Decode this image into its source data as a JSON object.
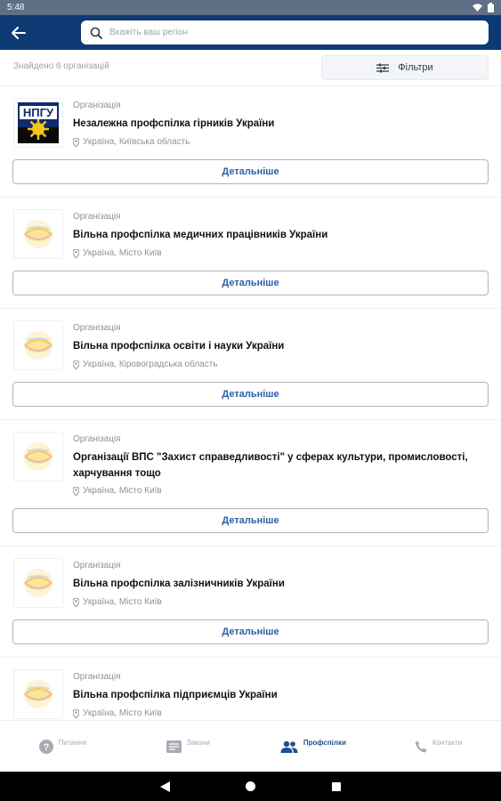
{
  "status": {
    "time": "5:48"
  },
  "search": {
    "placeholder": "Вкажіть ваш регіон"
  },
  "results": {
    "found_text": "Знайдено 6 організацій",
    "filter_label": "Фільтри"
  },
  "orgs": [
    {
      "type": "Організація",
      "name": "Незалежна профспілка гірників України",
      "location": "Україна, Київська область",
      "button": "Детальніше",
      "logo": "npgu-logo",
      "logo_text": "НПГУ"
    },
    {
      "type": "Організація",
      "name": "Вільна профспілка медичних працівників України",
      "location": "Україна, Місто Київ",
      "button": "Детальніше",
      "logo": "vpu-logo"
    },
    {
      "type": "Організація",
      "name": "Вільна профспілка освіти і науки України",
      "location": "Україна, Кіровоградська область",
      "button": "Детальніше",
      "logo": "vpu-logo"
    },
    {
      "type": "Організація",
      "name": "Організації ВПС \"Захист справедливості\" у сферах культури, промисловості, харчування тощо",
      "location": "Україна, Місто Київ",
      "button": "Детальніше",
      "logo": "vpu-logo"
    },
    {
      "type": "Організація",
      "name": "Вільна профспілка залізничників України",
      "location": "Україна, Місто Київ",
      "button": "Детальніше",
      "logo": "vpu-logo"
    },
    {
      "type": "Організація",
      "name": "Вільна профспілка підприємців України",
      "location": "Україна, Місто Київ",
      "button": "Детальніше",
      "logo": "vpu-logo"
    }
  ],
  "nav": [
    {
      "label": "Питання",
      "icon": "question-icon"
    },
    {
      "label": "Закони",
      "icon": "laws-icon"
    },
    {
      "label": "Профспілки",
      "icon": "people-icon",
      "active": true
    },
    {
      "label": "Контакти",
      "icon": "phone-icon"
    }
  ],
  "colors": {
    "app_bar": "#0d3a73",
    "accent": "#2a5fa8",
    "status_bar": "#5e6f86"
  }
}
